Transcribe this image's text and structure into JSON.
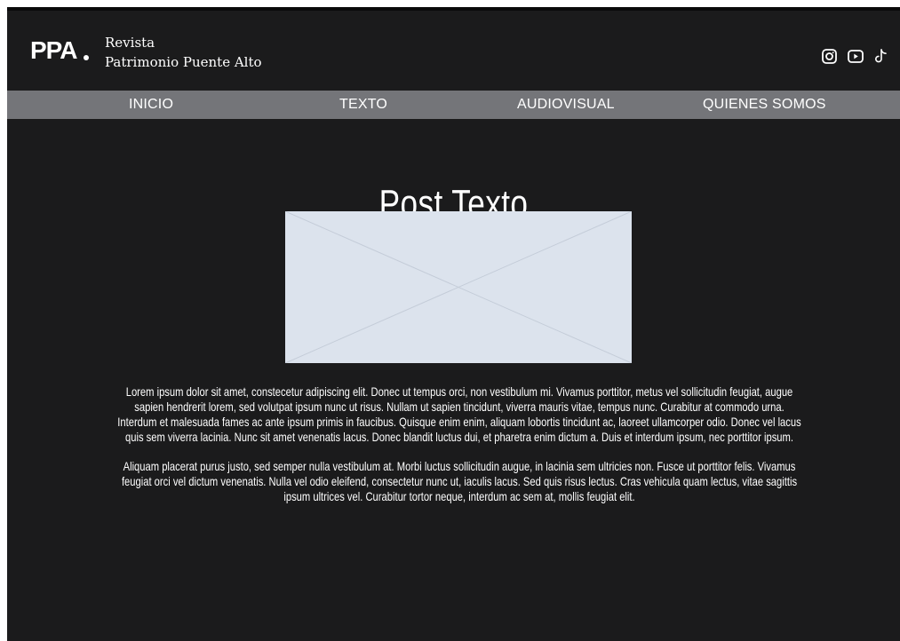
{
  "header": {
    "logo_text": "PPA",
    "brand_line_1": "Revista",
    "brand_line_2": "Patrimonio Puente Alto",
    "social_icons": [
      "instagram-icon",
      "youtube-icon",
      "tiktok-icon"
    ]
  },
  "nav": {
    "items": [
      {
        "label": "INICIO"
      },
      {
        "label": "TEXTO"
      },
      {
        "label": "AUDIOVISUAL"
      },
      {
        "label": "QUIENES SOMOS"
      }
    ]
  },
  "main": {
    "title": "Post Texto",
    "paragraphs": [
      "Lorem ipsum dolor sit amet, constecetur adipiscing elit. Donec ut tempus orci, non vestibulum mi. Vivamus porttitor, metus vel sollicitudin feugiat, augue sapien hendrerit lorem, sed volutpat ipsum nunc ut risus. Nullam ut sapien tincidunt, viverra mauris vitae, tempus nunc. Curabitur at commodo urna. Interdum et malesuada fames ac ante ipsum primis in faucibus. Quisque enim enim, aliquam lobortis tincidunt ac, laoreet ullamcorper odio. Donec vel lacus quis sem viverra lacinia. Nunc sit amet venenatis lacus. Donec blandit luctus dui, et pharetra enim dictum a. Duis et interdum ipsum, nec porttitor ipsum.",
      "Aliquam placerat purus justo, sed semper nulla vestibulum at. Morbi luctus sollicitudin augue, in lacinia sem ultricies non. Fusce ut porttitor felis. Vivamus feugiat orci vel dictum venenatis. Nulla vel odio eleifend, consectetur nunc ut, iaculis lacus. Sed quis risus lectus. Cras vehicula quam lectus, vitae sagittis ipsum ultrices vel. Curabitur tortor neque, interdum ac sem at, mollis feugiat elit."
    ]
  },
  "colors": {
    "background": "#1b1b1c",
    "nav_background": "#747579",
    "text": "#ffffff",
    "image_placeholder": "#dce3ed"
  }
}
